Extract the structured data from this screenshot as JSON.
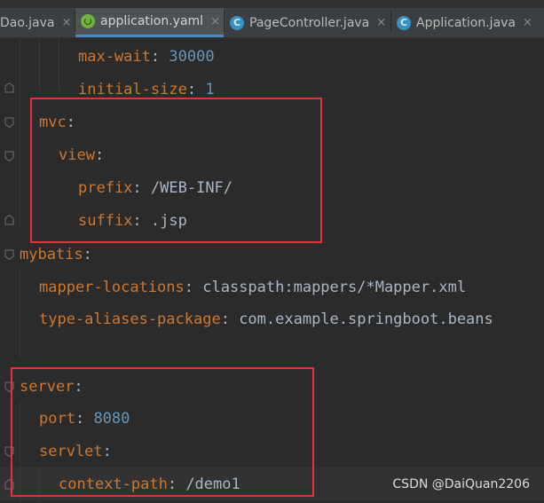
{
  "tabs": [
    {
      "label": "Dao.java",
      "icon": "java-class-icon",
      "active": false
    },
    {
      "label": "application.yaml",
      "icon": "spring-boot-icon",
      "active": true
    },
    {
      "label": "PageController.java",
      "icon": "java-class-icon",
      "active": false
    },
    {
      "label": "Application.java",
      "icon": "spring-boot-icon",
      "active": false
    }
  ],
  "tab_close_glyph": "×",
  "class_icon_glyph": "C",
  "code": {
    "l1": {
      "key": "max-wait",
      "sep": ": ",
      "value": "30000"
    },
    "l2": {
      "key": "initial-size",
      "sep": ": ",
      "value": "1"
    },
    "l3": {
      "key": "mvc",
      "sep": ":"
    },
    "l4": {
      "key": "view",
      "sep": ":"
    },
    "l5": {
      "key": "prefix",
      "sep": ": ",
      "value": "/WEB-INF/"
    },
    "l6": {
      "key": "suffix",
      "sep": ": ",
      "value": ".jsp"
    },
    "l7": {
      "key": "mybatis",
      "sep": ":"
    },
    "l8": {
      "key": "mapper-locations",
      "sep": ": ",
      "value": "classpath:mappers/*Mapper.xml"
    },
    "l9": {
      "key": "type-aliases-package",
      "sep": ": ",
      "value": "com.example.springboot.beans"
    },
    "l10": {
      "key": "server",
      "sep": ":"
    },
    "l11": {
      "key": "port",
      "sep": ": ",
      "value": "8080"
    },
    "l12": {
      "key": "servlet",
      "sep": ":"
    },
    "l13": {
      "key": "context-path",
      "sep": ": ",
      "value": "/demo1"
    }
  },
  "watermark": "CSDN @DaiQuan2206",
  "colors": {
    "key": "#cc7832",
    "number": "#6897bb",
    "string": "#a9b7c6",
    "highlight_box": "#e4323b",
    "background": "#2b2b2b"
  }
}
